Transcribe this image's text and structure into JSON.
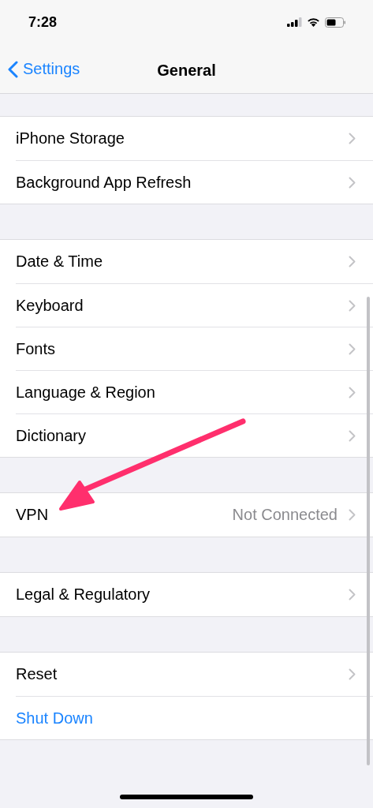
{
  "status_bar": {
    "time": "7:28"
  },
  "nav_bar": {
    "back": "Settings",
    "title": "General"
  },
  "groups": [
    {
      "rows": [
        {
          "kind": "nav",
          "label": "iPhone Storage"
        },
        {
          "kind": "nav",
          "label": "Background App Refresh"
        }
      ]
    },
    {
      "rows": [
        {
          "kind": "nav",
          "label": "Date & Time"
        },
        {
          "kind": "nav",
          "label": "Keyboard"
        },
        {
          "kind": "nav",
          "label": "Fonts"
        },
        {
          "kind": "nav",
          "label": "Language & Region"
        },
        {
          "kind": "nav",
          "label": "Dictionary"
        }
      ]
    },
    {
      "rows": [
        {
          "kind": "nav",
          "label": "VPN",
          "detail": "Not Connected"
        }
      ]
    },
    {
      "rows": [
        {
          "kind": "nav",
          "label": "Legal & Regulatory"
        }
      ]
    },
    {
      "rows": [
        {
          "kind": "nav",
          "label": "Reset"
        },
        {
          "kind": "action",
          "label": "Shut Down"
        }
      ]
    }
  ]
}
